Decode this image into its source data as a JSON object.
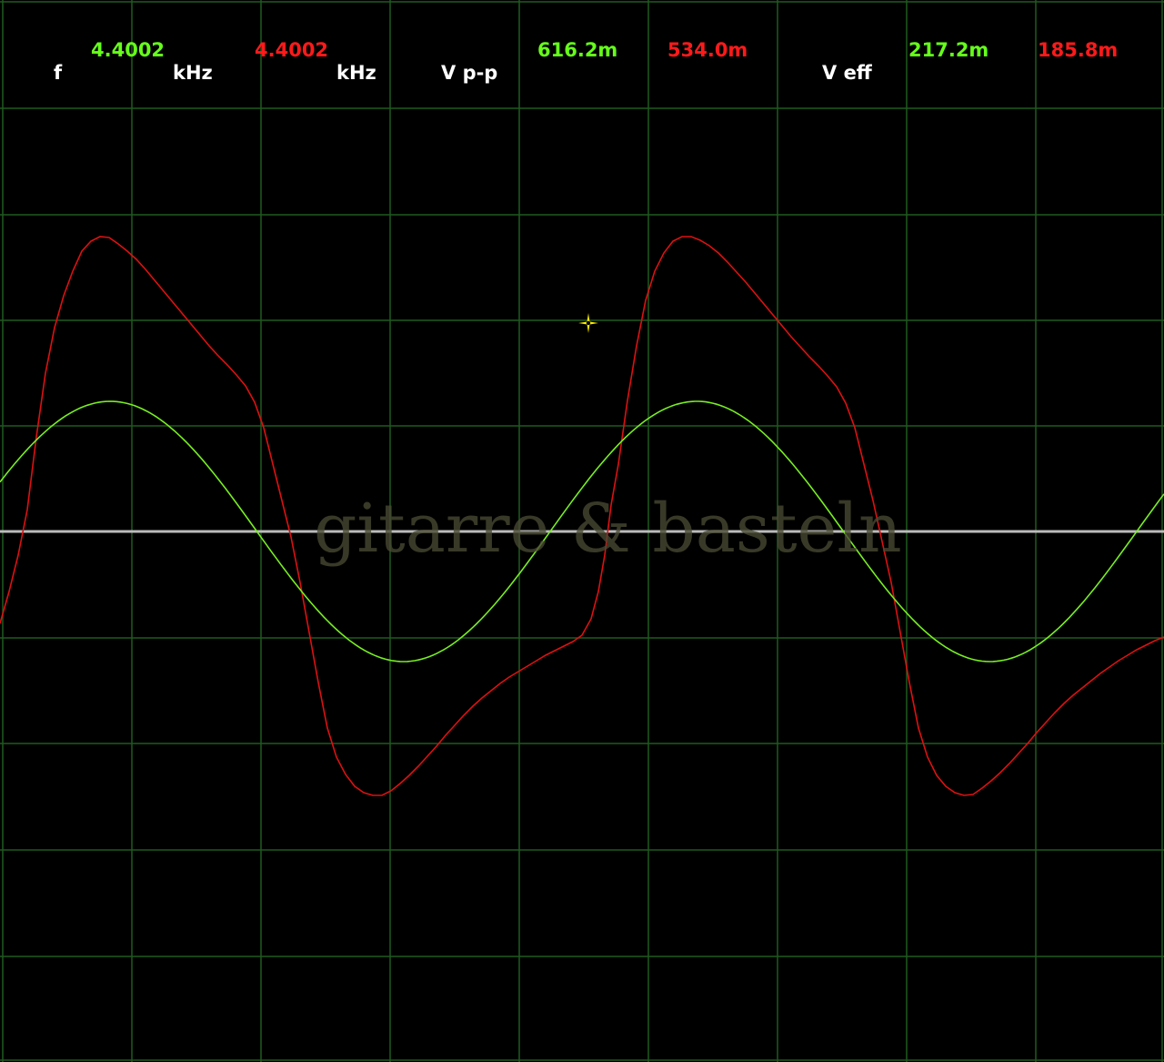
{
  "readouts": {
    "freq_label": "f",
    "ch1_freq": "4.4002",
    "ch1_freq_unit": "kHz",
    "ch2_freq": "4.4002",
    "ch2_freq_unit": "kHz",
    "vpp_label": "V p-p",
    "ch1_vpp": "616.2m",
    "ch2_vpp": "534.0m",
    "veff_label": "V eff",
    "ch1_veff": "217.2m",
    "ch2_veff": "185.8m"
  },
  "watermark": "gitarre & basteln",
  "colors": {
    "background": "#000000",
    "grid": "#1f5a1f",
    "zero_line": "#bbbbbb",
    "ch1_trace": "#77ee22",
    "ch2_trace": "#dd1111",
    "cursor": "#ffee00"
  },
  "traces": {
    "ch1_shape": "sine",
    "ch2_shape": "distorted-sawtooth"
  },
  "cursor_icon": "crosshair-star-icon"
}
